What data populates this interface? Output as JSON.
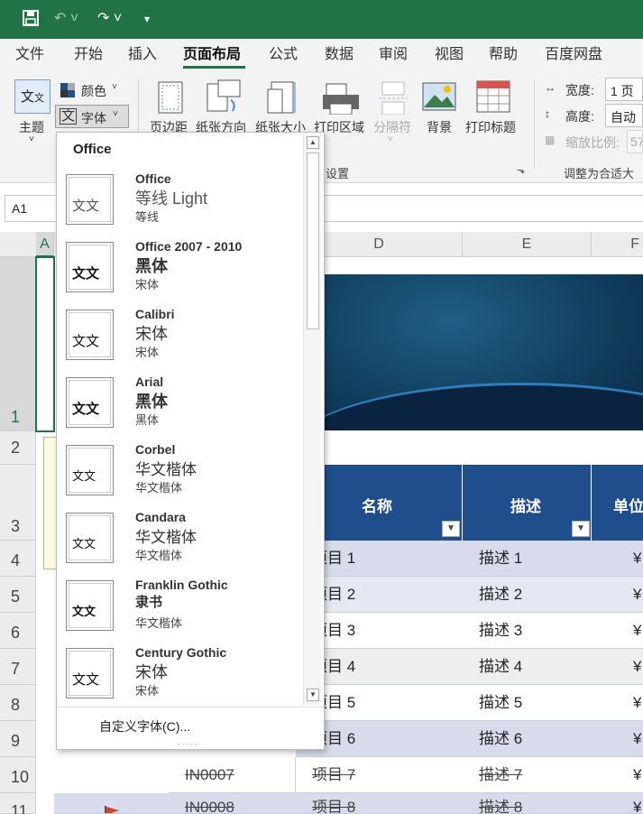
{
  "quick_access": {
    "save_icon": "save-icon",
    "undo_icon": "undo-icon",
    "redo_icon": "redo-icon",
    "customize_icon": "customize-icon"
  },
  "tabs": [
    "文件",
    "开始",
    "插入",
    "页面布局",
    "公式",
    "数据",
    "审阅",
    "视图",
    "帮助",
    "百度网盘"
  ],
  "ribbon": {
    "theme": "主题",
    "colors": "颜色",
    "fonts": "字体",
    "margins": "页边距",
    "orientation": "纸张方向",
    "size": "纸张大小",
    "print_area": "打印区域",
    "breaks": "分隔符",
    "background": "背景",
    "print_titles": "打印标题",
    "page_setup_group": "设置",
    "width_label": "宽度:",
    "width_value": "1 页",
    "height_label": "高度:",
    "height_value": "自动",
    "scale_label": "缩放比例:",
    "scale_value": "57",
    "scale_group": "调整为合适大"
  },
  "name_box": "A1",
  "columns": {
    "a": "A",
    "d": "D",
    "e": "E",
    "f": "F"
  },
  "rows": [
    "1",
    "2",
    "3",
    "4",
    "5",
    "6",
    "7",
    "8",
    "9",
    "10",
    "11"
  ],
  "table": {
    "headers": {
      "name": "名称",
      "desc": "描述",
      "unit": "单位"
    },
    "rows": [
      {
        "name": "项目 1",
        "desc": "描述 1",
        "unit": "¥"
      },
      {
        "name": "项目 2",
        "desc": "描述 2",
        "unit": "¥"
      },
      {
        "name": "项目 3",
        "desc": "描述 3",
        "unit": "¥"
      },
      {
        "name": "项目 4",
        "desc": "描述 4",
        "unit": "¥"
      },
      {
        "name": "项目 5",
        "desc": "描述 5",
        "unit": "¥"
      },
      {
        "name": "项目 6",
        "desc": "描述 6",
        "unit": "¥"
      },
      {
        "name": "项目 7",
        "desc": "描述 7",
        "unit": "¥",
        "id": "IN0007"
      },
      {
        "name": "项目 8",
        "desc": "描述 8",
        "unit": "¥",
        "id": "IN0008"
      }
    ]
  },
  "font_menu": {
    "section": "Office",
    "thumb_text": "文文",
    "items": [
      {
        "name": "Office",
        "heading": "等线 Light",
        "body": "等线"
      },
      {
        "name": "Office 2007 - 2010",
        "heading": "黑体",
        "body": "宋体"
      },
      {
        "name": "Calibri",
        "heading": "宋体",
        "body": "宋体"
      },
      {
        "name": "Arial",
        "heading": "黑体",
        "body": "黑体"
      },
      {
        "name": "Corbel",
        "heading": "华文楷体",
        "body": "华文楷体"
      },
      {
        "name": "Candara",
        "heading": "华文楷体",
        "body": "华文楷体"
      },
      {
        "name": "Franklin Gothic",
        "heading": "隶书",
        "body": "华文楷体"
      },
      {
        "name": "Century Gothic",
        "heading": "宋体",
        "body": "宋体"
      }
    ],
    "custom": "自定义字体(C)...",
    "grip": "....."
  },
  "colors": {
    "title_bar": "#217346",
    "table_header": "#1f4e8c",
    "band": "#d7dbeb"
  }
}
